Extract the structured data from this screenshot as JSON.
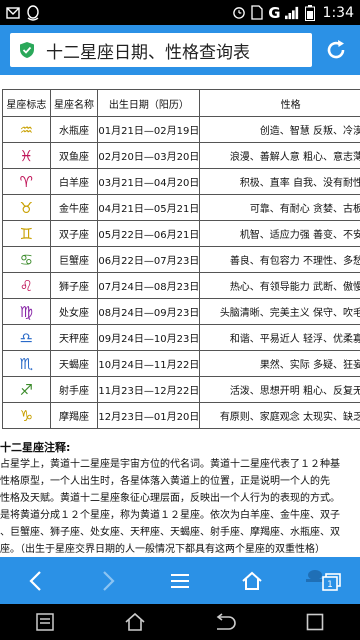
{
  "status": {
    "network": "G",
    "time": "1:34"
  },
  "address": {
    "title": "十二星座日期、性格查询表"
  },
  "table": {
    "headers": [
      "星座标志",
      "星座名称",
      "出生日期（阳历）",
      "性格"
    ],
    "rows": [
      {
        "symbol": "♒",
        "name": "水瓶座",
        "date": "01月21日—02月19日",
        "trait": "创造、智慧 反叛、冷漠",
        "color": "#c8a000"
      },
      {
        "symbol": "♓",
        "name": "双鱼座",
        "date": "02月20日—03月20日",
        "trait": "浪漫、善解人意 粗心、意志薄",
        "color": "#c0165a"
      },
      {
        "symbol": "♈",
        "name": "白羊座",
        "date": "03月21日—04月20日",
        "trait": "积极、直率 自我、没有耐性",
        "color": "#c0165a"
      },
      {
        "symbol": "♉",
        "name": "金牛座",
        "date": "04月21日—05月21日",
        "trait": "可靠、有耐心 贪婪、古板",
        "color": "#c8a000"
      },
      {
        "symbol": "♊",
        "name": "双子座",
        "date": "05月22日—06月21日",
        "trait": "机智、适应力强 善变、不安",
        "color": "#c8a000"
      },
      {
        "symbol": "♋",
        "name": "巨蟹座",
        "date": "06月22日—07月23日",
        "trait": "善良、有包容力 不理性、多愁",
        "color": "#3a8a2a"
      },
      {
        "symbol": "♌",
        "name": "狮子座",
        "date": "07月24日—08月23日",
        "trait": "热心、有领导能力 武断、傲慢",
        "color": "#c0165a"
      },
      {
        "symbol": "♍",
        "name": "处女座",
        "date": "08月24日—09月23日",
        "trait": "头脑清晰、完美主义 保守、吹毛",
        "color": "#8a2aa8"
      },
      {
        "symbol": "♎",
        "name": "天秤座",
        "date": "09月24日—10月23日",
        "trait": "和谐、平易近人 轻浮、优柔寡",
        "color": "#2a6ac8"
      },
      {
        "symbol": "♏",
        "name": "天蝎座",
        "date": "10月24日—11月22日",
        "trait": "果然、实际 多疑、狂妄",
        "color": "#2a6ac8"
      },
      {
        "symbol": "♐",
        "name": "射手座",
        "date": "11月23日—12月22日",
        "trait": "活泼、思想开明 粗心、反复无",
        "color": "#3a8a2a"
      },
      {
        "symbol": "♑",
        "name": "摩羯座",
        "date": "12月23日—01月20日",
        "trait": "有原则、家庭观念 太现实、缺乏",
        "color": "#c8a000"
      }
    ]
  },
  "notes": {
    "title": "十二星座注释:",
    "lines": [
      "占星学上，黄道十二星座是宇宙方位的代名词。黄道十二星座代表了１２种基",
      "性格原型，一个人出生时，各星体落入黄道上的位置，正是说明一个人的先",
      "性格及天赋。黄道十二星座象征心理层面，反映出一个人行为的表现的方式。",
      "是将黄道分成１２个星座，称为黄道１２星座。依次为白羊座、金牛座、双子",
      "、巨蟹座、狮子座、处女座、天秤座、天蝎座、射手座、摩羯座、水瓶座、双",
      "座。（出生于星座交界日期的人一般情况下都具有这两个星座的双重性格）"
    ]
  },
  "colors": {
    "accent": "#2b91e6",
    "shield": "#2aa85a"
  }
}
